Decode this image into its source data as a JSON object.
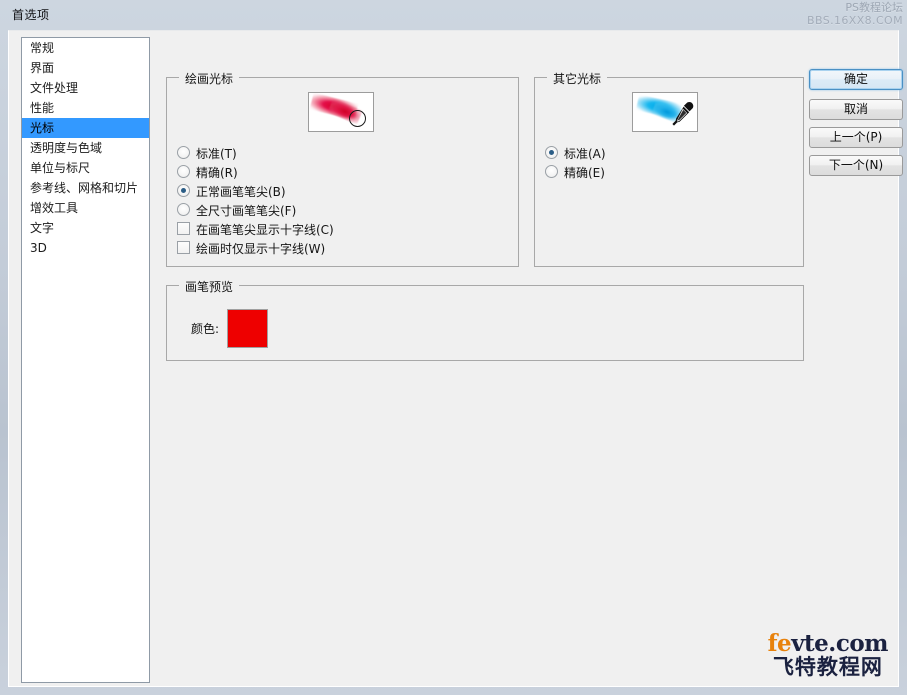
{
  "window": {
    "title": "首选项"
  },
  "watermark_top": {
    "line1": "PS教程论坛",
    "line2": "BBS.16XX8.COM"
  },
  "watermark_bottom": {
    "domain_accent": "fe",
    "domain_rest": "vte.com",
    "subtitle": "飞特教程网"
  },
  "sidebar": {
    "items": [
      {
        "label": "常规",
        "selected": false
      },
      {
        "label": "界面",
        "selected": false
      },
      {
        "label": "文件处理",
        "selected": false
      },
      {
        "label": "性能",
        "selected": false
      },
      {
        "label": "光标",
        "selected": true
      },
      {
        "label": "透明度与色域",
        "selected": false
      },
      {
        "label": "单位与标尺",
        "selected": false
      },
      {
        "label": "参考线、网格和切片",
        "selected": false
      },
      {
        "label": "增效工具",
        "selected": false
      },
      {
        "label": "文字",
        "selected": false
      },
      {
        "label": "3D",
        "selected": false
      }
    ]
  },
  "painting_cursors": {
    "title": "绘画光标",
    "preview_icon": "red-brush-stroke-with-brush-tip-cursor",
    "options": [
      {
        "label": "标准(T)",
        "type": "radio",
        "checked": false
      },
      {
        "label": "精确(R)",
        "type": "radio",
        "checked": false
      },
      {
        "label": "正常画笔笔尖(B)",
        "type": "radio",
        "checked": true
      },
      {
        "label": "全尺寸画笔笔尖(F)",
        "type": "radio",
        "checked": false
      },
      {
        "label": "在画笔笔尖显示十字线(C)",
        "type": "checkbox",
        "checked": false
      },
      {
        "label": "绘画时仅显示十字线(W)",
        "type": "checkbox",
        "checked": false
      }
    ]
  },
  "other_cursors": {
    "title": "其它光标",
    "preview_icon": "cyan-stroke-with-eyedropper-cursor",
    "options": [
      {
        "label": "标准(A)",
        "type": "radio",
        "checked": true
      },
      {
        "label": "精确(E)",
        "type": "radio",
        "checked": false
      }
    ]
  },
  "brush_preview": {
    "title": "画笔预览",
    "color_label": "颜色:",
    "color_value": "#ee0000"
  },
  "buttons": {
    "ok": "确定",
    "cancel": "取消",
    "previous": "上一个(P)",
    "next": "下一个(N)"
  },
  "colors": {
    "selection": "#3399ff",
    "dialog_bg": "#f0f0f0",
    "swatch": "#ee0000",
    "accent_watermark": "#e8820c"
  }
}
